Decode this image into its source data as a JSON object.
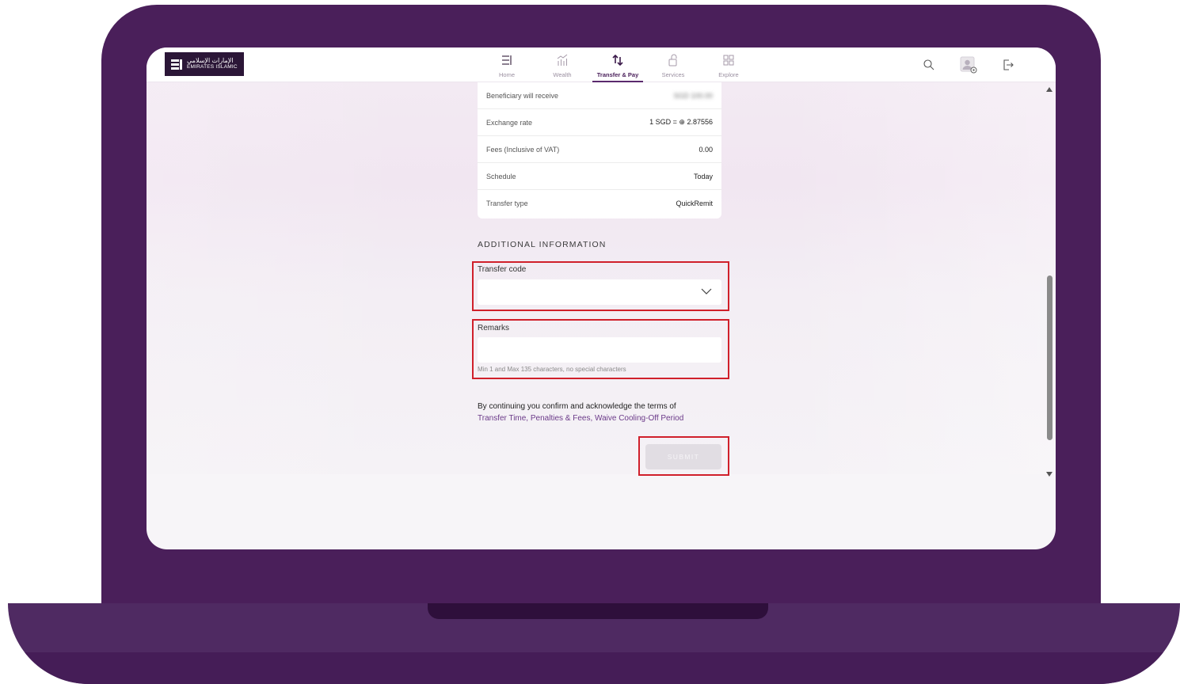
{
  "brand": {
    "logo_ar": "الإمارات الإسلامي",
    "logo_en": "EMIRATES ISLAMIC"
  },
  "nav": {
    "items": [
      {
        "label": "Home",
        "icon": "home-menu-icon"
      },
      {
        "label": "Wealth",
        "icon": "wealth-chart-icon"
      },
      {
        "label": "Transfer & Pay",
        "icon": "transfer-arrows-icon",
        "active": true
      },
      {
        "label": "Services",
        "icon": "services-icon"
      },
      {
        "label": "Explore",
        "icon": "explore-grid-icon"
      }
    ]
  },
  "summary": {
    "rows": [
      {
        "key": "Beneficiary will receive",
        "value": "SGD 100.00"
      },
      {
        "key": "Exchange rate",
        "value": "1 SGD = ⊕ 2.87556"
      },
      {
        "key": "Fees (Inclusive of VAT)",
        "value": "0.00"
      },
      {
        "key": "Schedule",
        "value": "Today"
      },
      {
        "key": "Transfer type",
        "value": "QuickRemit"
      }
    ]
  },
  "additional": {
    "title": "ADDITIONAL INFORMATION",
    "transfer_code_label": "Transfer code",
    "transfer_code_value": "",
    "remarks_label": "Remarks",
    "remarks_value": "",
    "remarks_hint": "Min 1 and Max 135 characters, no special characters"
  },
  "terms": {
    "text": "By continuing you confirm and acknowledge the terms of",
    "links": "Transfer Time, Penalties & Fees, Waive Cooling-Off Period"
  },
  "submit_label": "SUBMIT",
  "colors": {
    "laptop": "#4a1f5a",
    "accent": "#5a2a6d",
    "link": "#6b3a89",
    "highlight": "#d0202b"
  }
}
